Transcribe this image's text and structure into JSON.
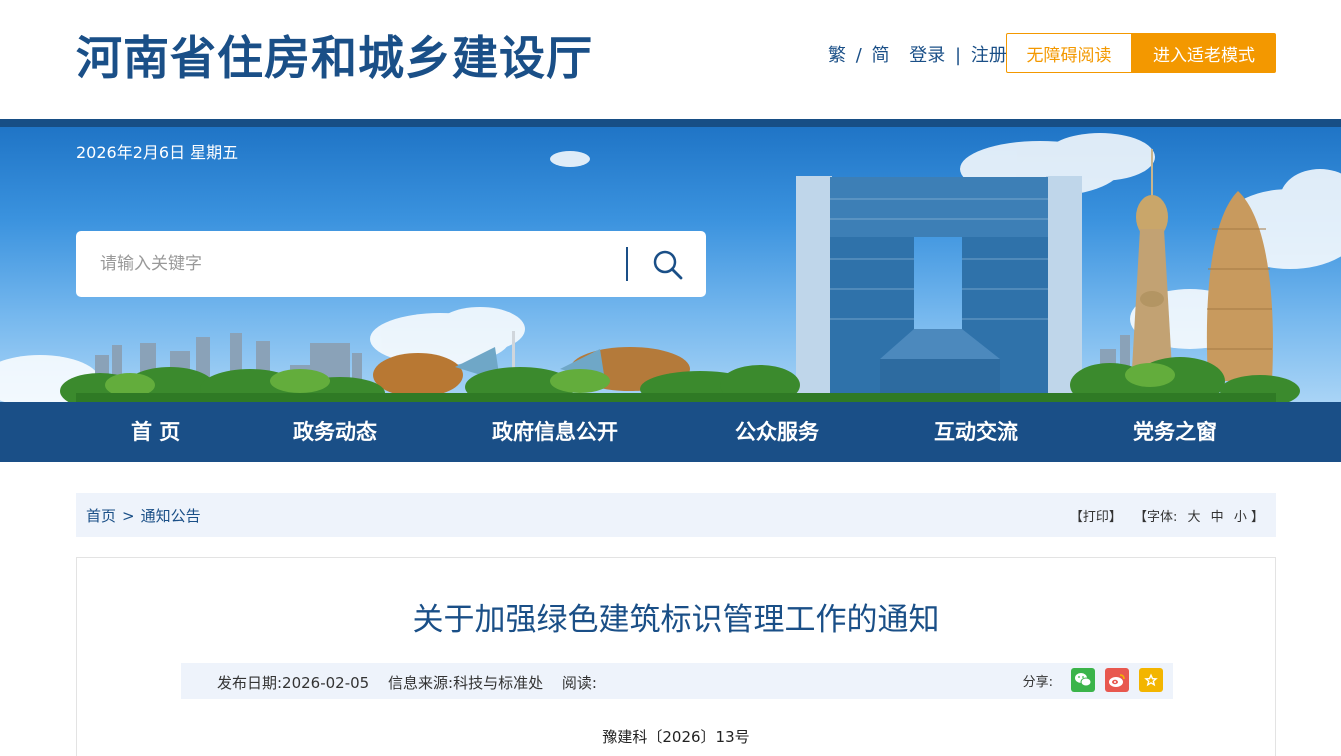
{
  "header": {
    "site_title": "河南省住房和城乡建设厅",
    "lang_trad": "繁",
    "lang_sep": "/",
    "lang_simp": "简",
    "login": "登录",
    "auth_sep": "|",
    "register": "注册",
    "accessibility_label": "无障碍阅读",
    "elder_mode_label": "进入适老模式"
  },
  "banner": {
    "date": "2026年2月6日 星期五",
    "search_placeholder": "请输入关键字",
    "search_icon": "search-icon"
  },
  "nav": {
    "items": [
      {
        "label": "首 页"
      },
      {
        "label": "政务动态"
      },
      {
        "label": "政府信息公开"
      },
      {
        "label": "公众服务"
      },
      {
        "label": "互动交流"
      },
      {
        "label": "党务之窗"
      }
    ]
  },
  "breadcrumb": {
    "home": "首页",
    "separator": ">",
    "current": "通知公告"
  },
  "tools": {
    "print": "【打印】",
    "font_prefix": "【字体:",
    "font_large": "大",
    "font_medium": "中",
    "font_small": "小",
    "font_suffix": "】"
  },
  "article": {
    "title": "关于加强绿色建筑标识管理工作的通知",
    "publish_date": "发布日期:2026-02-05",
    "source": "信息来源:科技与标准处",
    "reads": "阅读:",
    "share_label": "分享:",
    "share_icons": [
      "wechat-icon",
      "weibo-icon",
      "favorite-star-icon"
    ],
    "doc_number": "豫建科〔2026〕13号"
  },
  "colors": {
    "brand_blue": "#1a4f87",
    "accent_orange": "#f39800",
    "light_bg": "#eef3fb",
    "wechat_green": "#3bb44a",
    "weibo_red": "#e8584f",
    "star_yellow": "#f3b500"
  }
}
